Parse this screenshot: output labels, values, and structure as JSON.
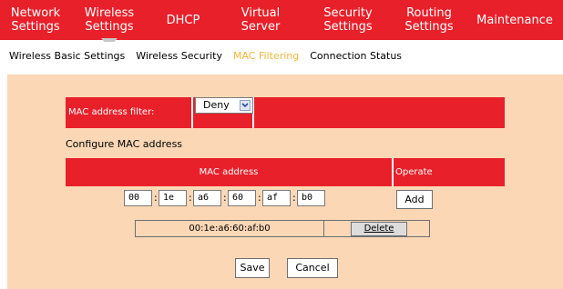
{
  "topnav": {
    "items": [
      {
        "label": "Network\nSettings"
      },
      {
        "label": "Wireless\nSettings"
      },
      {
        "label": "DHCP"
      },
      {
        "label": "Virtual\nServer"
      },
      {
        "label": "Security\nSettings"
      },
      {
        "label": "Routing\nSettings"
      },
      {
        "label": "Maintenance"
      }
    ]
  },
  "subnav": {
    "items": [
      {
        "label": "Wireless Basic Settings"
      },
      {
        "label": "Wireless Security"
      },
      {
        "label": "MAC Filtering"
      },
      {
        "label": "Connection Status"
      }
    ]
  },
  "filter": {
    "label": "MAC address filter:",
    "selected": "Deny"
  },
  "config_label": "Configure MAC address",
  "table_header": {
    "mac": "MAC address",
    "operate": "Operate"
  },
  "mac_inputs": [
    "00",
    "1e",
    "a6",
    "60",
    "af",
    "b0"
  ],
  "colon": ":",
  "add_label": "Add",
  "entries": [
    {
      "mac": "00:1e:a6:60:af:b0",
      "delete_label": "Delete"
    }
  ],
  "save_label": "Save",
  "cancel_label": "Cancel",
  "colors": {
    "accent": "#e8202a",
    "panel": "#fbd7b5",
    "active_subnav": "#f5b53a"
  }
}
